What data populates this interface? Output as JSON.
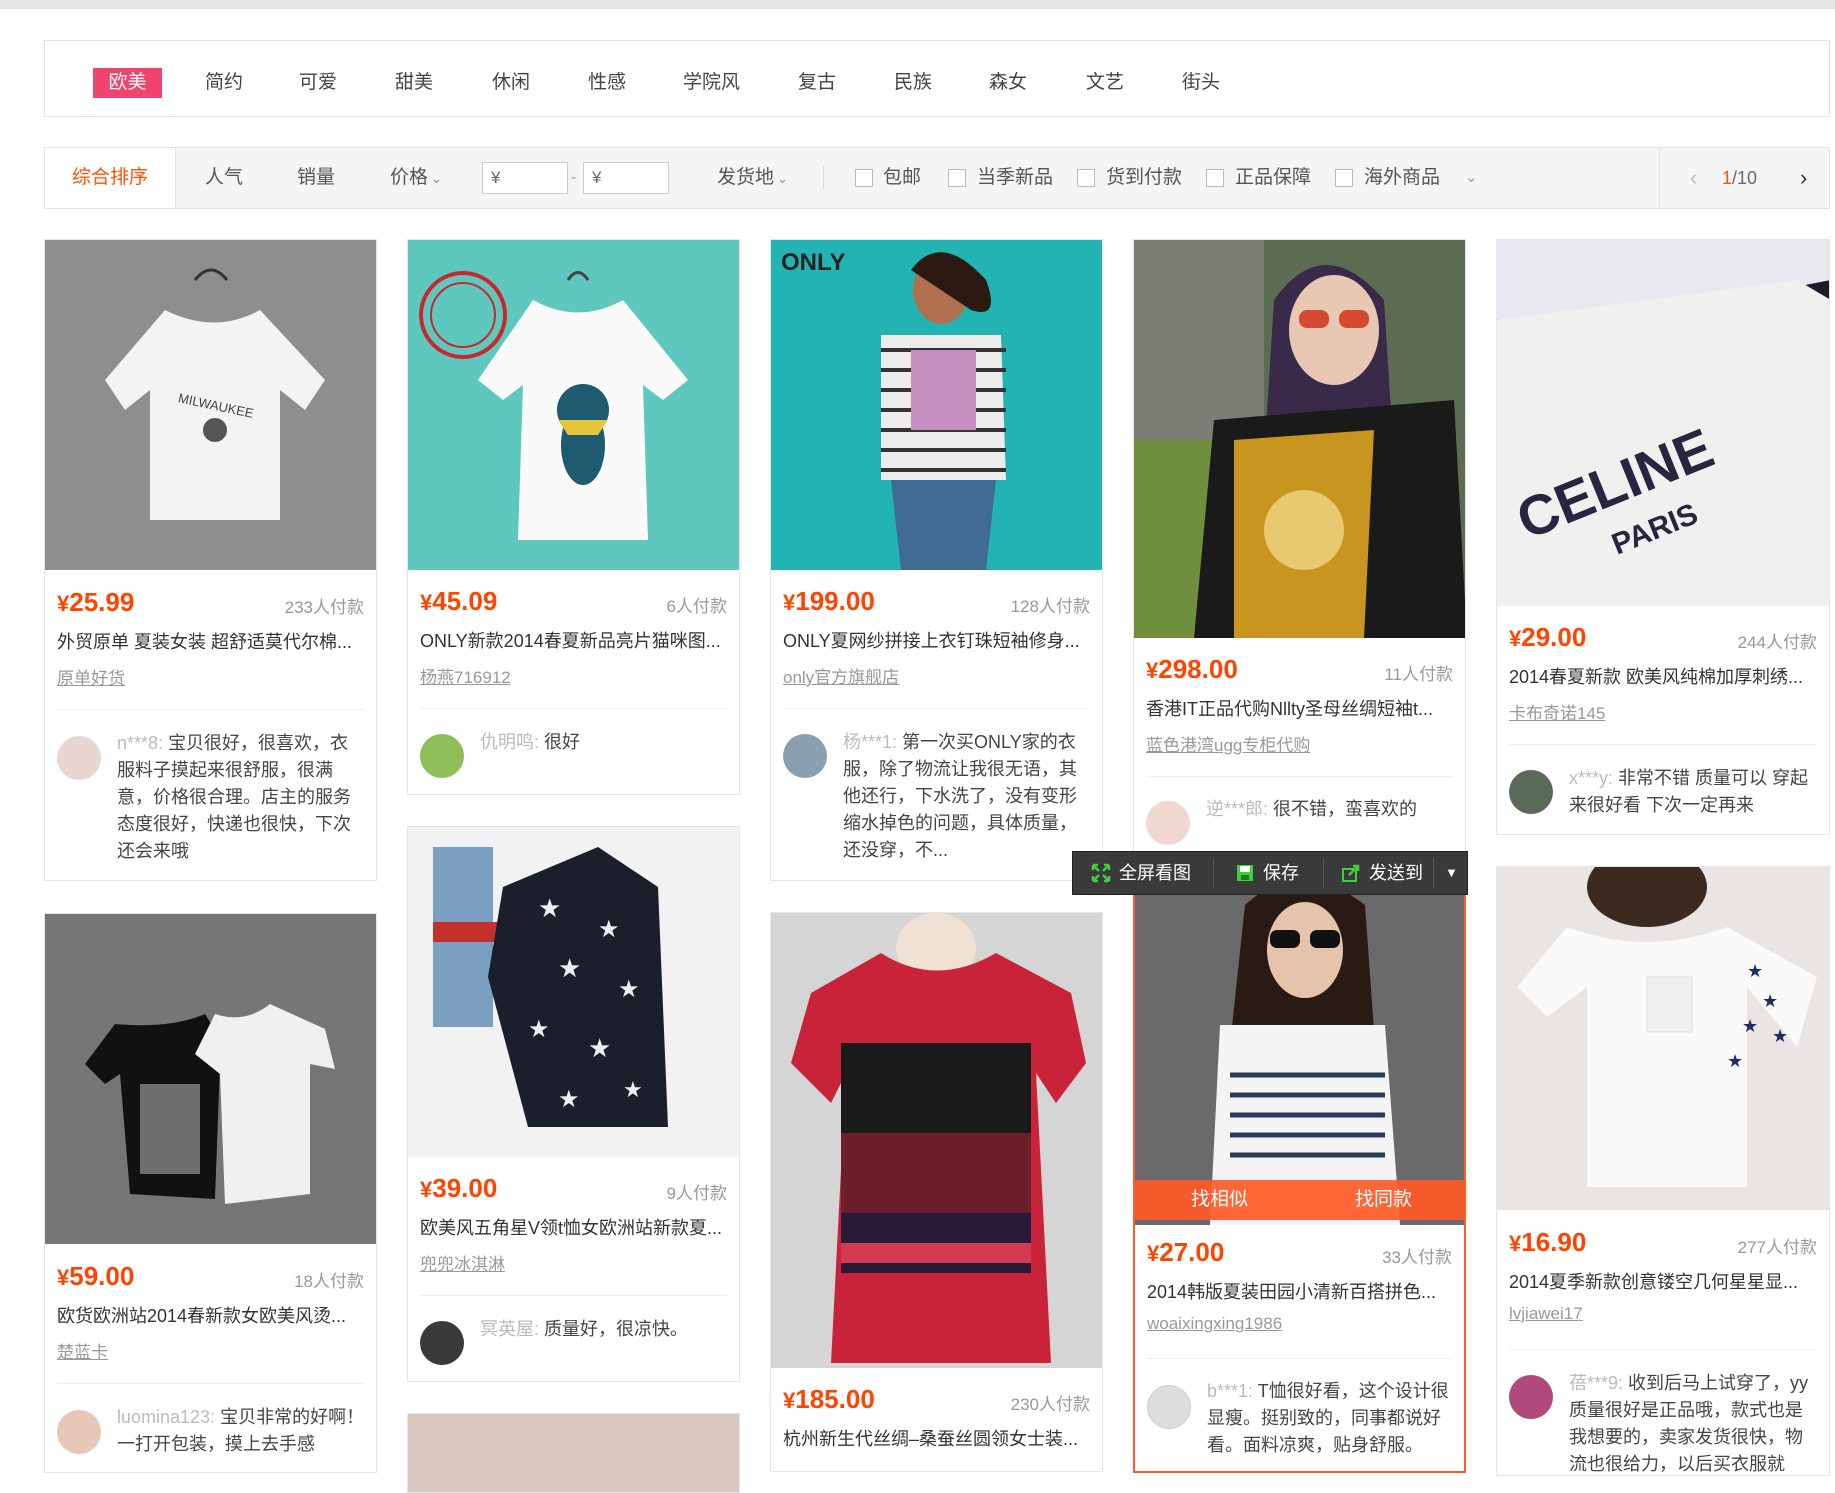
{
  "style_tags": [
    "欧美",
    "简约",
    "可爱",
    "甜美",
    "休闲",
    "性感",
    "学院风",
    "复古",
    "民族",
    "森女",
    "文艺",
    "街头"
  ],
  "filters": {
    "sorts": [
      "综合排序",
      "人气",
      "销量",
      "价格"
    ],
    "price_min_placeholder": "¥",
    "price_max_placeholder": "¥",
    "price_dash": "-",
    "location": "发货地",
    "checkboxes": [
      "包邮",
      "当季新品",
      "货到付款",
      "正品保障",
      "海外商品"
    ],
    "page_current": "1",
    "page_total": "/10"
  },
  "image_tools": {
    "fullscreen": "全屏看图",
    "save": "保存",
    "send": "发送到"
  },
  "similar": {
    "find_similar": "找相似",
    "find_same": "找同款"
  },
  "products": [
    {
      "price": "25.99",
      "sold": "233人付款",
      "title": "外贸原单 夏装女装 超舒适莫代尔棉...",
      "shop": "原单好货",
      "review_user": "n***8:",
      "review": "宝贝很好，很喜欢，衣服料子摸起来很舒服，很满意，价格很合理。店主的服务态度很好，快递也很快，下次还会来哦"
    },
    {
      "price": "45.09",
      "sold": "6人付款",
      "title": "ONLY新款2014春夏新品亮片猫咪图...",
      "shop": "杨燕716912",
      "review_user": "仇明鸣:",
      "review": "很好"
    },
    {
      "price": "199.00",
      "sold": "128人付款",
      "title": "ONLY夏网纱拼接上衣钉珠短袖修身...",
      "shop": "only官方旗舰店",
      "review_user": "杨***1:",
      "review": "第一次买ONLY家的衣服，除了物流让我很无语，其他还行，下水洗了，没有变形缩水掉色的问题，具体质量，还没穿，不..."
    },
    {
      "price": "298.00",
      "sold": "11人付款",
      "title": "香港IT正品代购Nllty圣母丝绸短袖t...",
      "shop": "蓝色港湾ugg专柜代购",
      "review_user": "逆***郎:",
      "review": "很不错，蛮喜欢的"
    },
    {
      "price": "29.00",
      "sold": "244人付款",
      "title": "2014春夏新款 欧美风纯棉加厚刺绣...",
      "shop": "卡布奇诺145",
      "review_user": "x***y:",
      "review": "非常不错 质量可以 穿起来很好看 下次一定再来"
    },
    {
      "price": "59.00",
      "sold": "18人付款",
      "title": "欧货欧洲站2014春新款女欧美风烫...",
      "shop": "楚蓝卡",
      "review_user": "luomina123:",
      "review": "宝贝非常的好啊！一打开包装，摸上去手感"
    },
    {
      "price": "39.00",
      "sold": "9人付款",
      "title": "欧美风五角星V领t恤女欧洲站新款夏...",
      "shop": "兜兜冰淇淋",
      "review_user": "冥英屋:",
      "review": "质量好，很凉快。"
    },
    {
      "price": "185.00",
      "sold": "230人付款",
      "title": "杭州新生代丝绸–桑蚕丝圆领女士装..."
    },
    {
      "price": "27.00",
      "sold": "33人付款",
      "title": "2014韩版夏装田园小清新百搭拼色...",
      "shop": "woaixingxing1986",
      "review_user": "b***1:",
      "review": "T恤很好看，这个设计很显瘦。挺别致的，同事都说好看。面料凉爽，贴身舒服。"
    },
    {
      "price": "16.90",
      "sold": "277人付款",
      "title": "2014夏季新款创意镂空几何星星显...",
      "shop": "lvjiawei17",
      "review_user": "蓓***9:",
      "review": "收到后马上试穿了，yy质量很好是正品哦，款式也是我想要的，卖家发货很快，物流也很给力，以后买衣服就"
    }
  ],
  "logos": {
    "only": "ONLY",
    "celine_line1": "CELINE",
    "celine_line2": "PARIS",
    "milwaukee": "MILWAUKEE"
  }
}
